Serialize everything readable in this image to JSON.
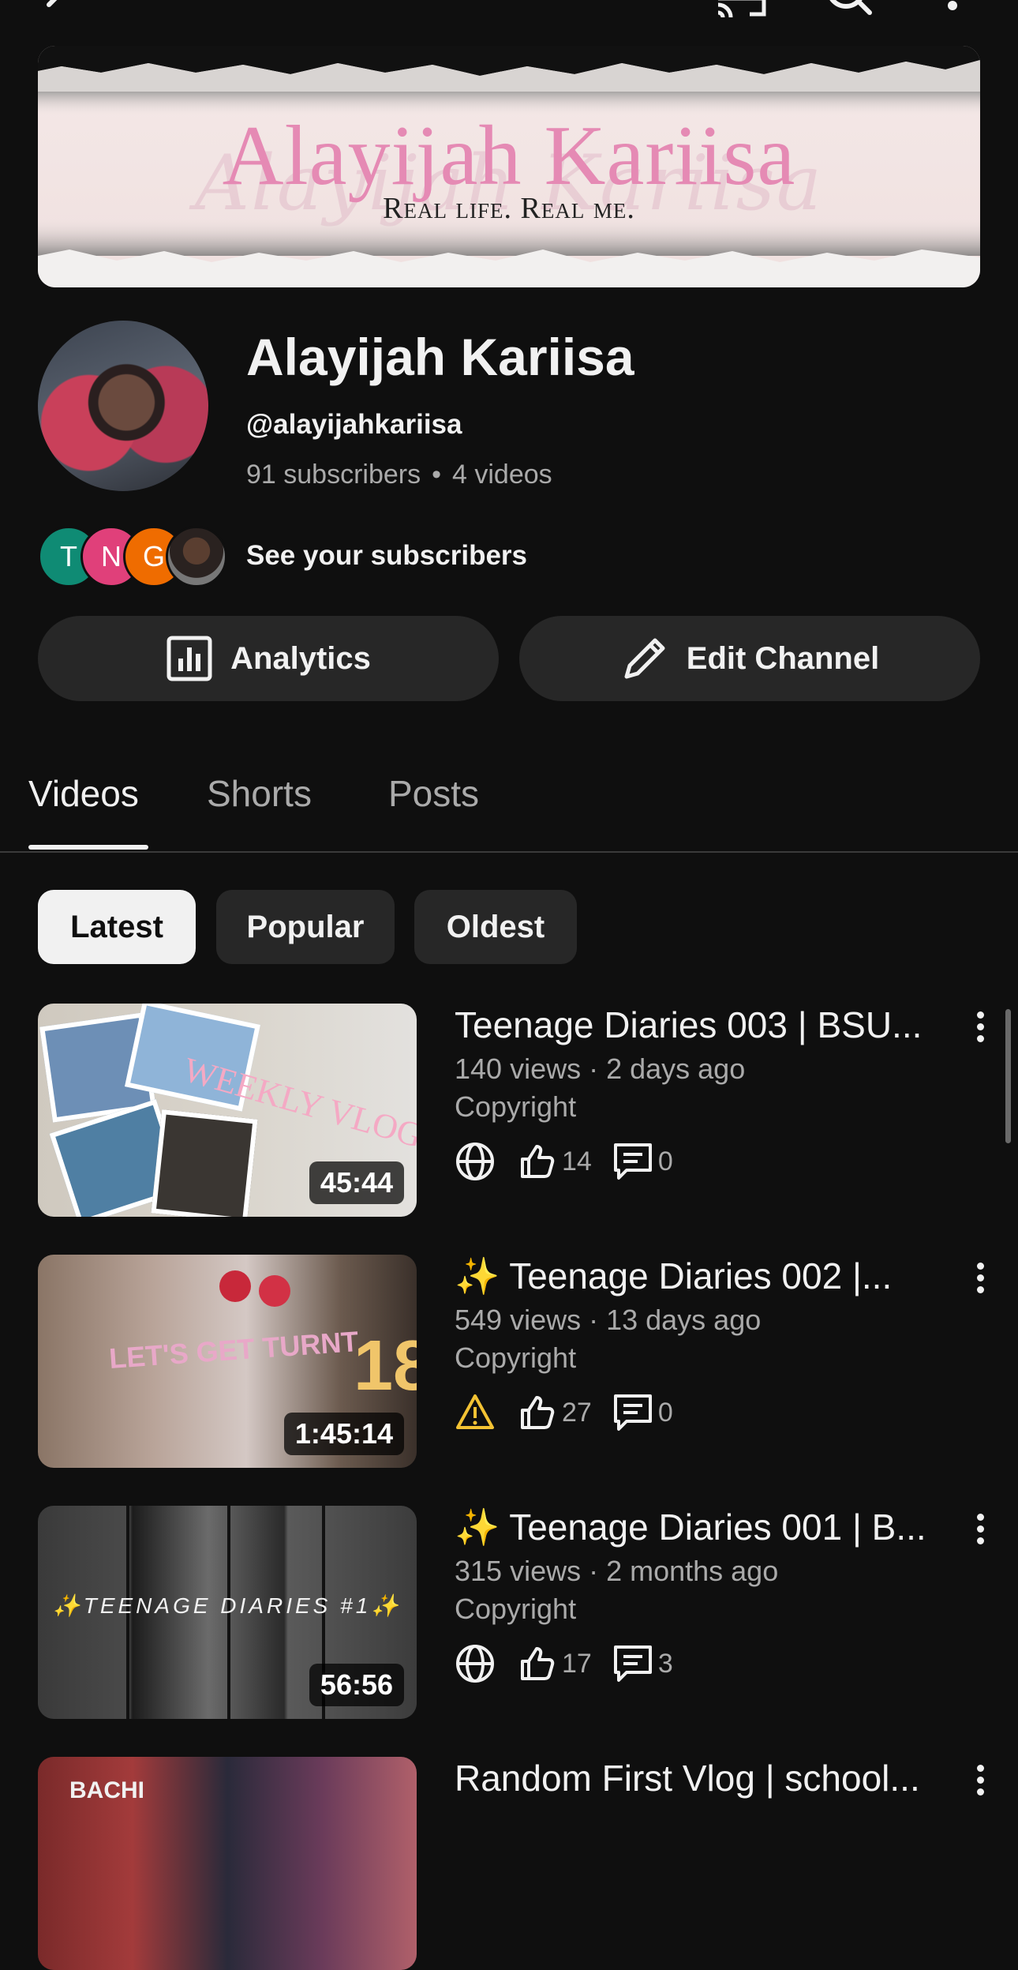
{
  "topbar": {
    "icons": [
      "back-icon",
      "cast-icon",
      "search-icon",
      "more-icon"
    ]
  },
  "banner": {
    "title": "Alayijah Kariisa",
    "script_text": "Alayijah Kariisa",
    "tagline": "Real life. Real me."
  },
  "channel": {
    "name": "Alayijah Kariisa",
    "handle": "@alayijahkariisa",
    "subscribers": "91 subscribers",
    "separator": "•",
    "videos": "4 videos"
  },
  "subscribers_preview": {
    "avatars": [
      {
        "letter": "T",
        "color": "#0f8b74"
      },
      {
        "letter": "N",
        "color": "#e0407a"
      },
      {
        "letter": "G",
        "color": "#ef6c00"
      }
    ],
    "label": "See your subscribers"
  },
  "buttons": {
    "analytics": "Analytics",
    "edit_channel": "Edit Channel"
  },
  "tabs": [
    {
      "label": "Videos",
      "active": true
    },
    {
      "label": "Shorts",
      "active": false
    },
    {
      "label": "Posts",
      "active": false
    }
  ],
  "chips": [
    {
      "label": "Latest",
      "active": true
    },
    {
      "label": "Popular",
      "active": false
    },
    {
      "label": "Oldest",
      "active": false
    }
  ],
  "videos": [
    {
      "title": "Teenage Diaries 003 | BSU...",
      "meta": "140 views · 2 days ago",
      "copyright": "Copyright",
      "visibility_icon": "globe-icon",
      "likes": "14",
      "comments": "0",
      "duration": "45:44",
      "thumb_text": "WEEKLY VLOG"
    },
    {
      "title": "✨ Teenage Diaries 002 |...",
      "meta": "549 views · 13 days ago",
      "copyright": "Copyright",
      "visibility_icon": "warning-icon",
      "likes": "27",
      "comments": "0",
      "duration": "1:45:14",
      "thumb_text": "LET'S GET TURNT"
    },
    {
      "title": "✨ Teenage Diaries 001 | B...",
      "meta": "315 views · 2 months ago",
      "copyright": "Copyright",
      "visibility_icon": "globe-icon",
      "likes": "17",
      "comments": "3",
      "duration": "56:56",
      "thumb_text": "✨TEENAGE DIARIES #1✨"
    },
    {
      "title": "Random First Vlog | school...",
      "meta": "",
      "copyright": "",
      "visibility_icon": "",
      "likes": "",
      "comments": "",
      "duration": "",
      "thumb_text": "BACHI"
    }
  ],
  "colors": {
    "background": "#0f0f0f",
    "surface": "#272727",
    "banner_pink": "#e58ab4",
    "warning": "#f3c233"
  }
}
